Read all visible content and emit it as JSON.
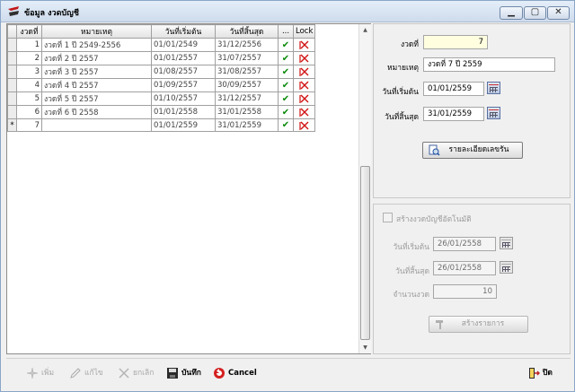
{
  "window": {
    "title": "ข้อมูล งวดบัญชี",
    "controls": {
      "minimize": "▁",
      "maximize": "▢",
      "close": "✕"
    }
  },
  "grid": {
    "columns": [
      "งวดที่",
      "หมายเหตุ",
      "วันที่เริ่มต้น",
      "วันที่สิ้นสุด",
      "...",
      "Lock"
    ],
    "rows": [
      {
        "period": "1",
        "note": "งวดที่ 1 ปี 2549-2556",
        "start": "01/01/2549",
        "end": "31/12/2556"
      },
      {
        "period": "2",
        "note": "งวดที่ 2 ปี 2557",
        "start": "01/01/2557",
        "end": "31/07/2557"
      },
      {
        "period": "3",
        "note": "งวดที่ 3 ปี 2557",
        "start": "01/08/2557",
        "end": "31/08/2557"
      },
      {
        "period": "4",
        "note": "งวดที่ 4 ปี 2557",
        "start": "01/09/2557",
        "end": "30/09/2557"
      },
      {
        "period": "5",
        "note": "งวดที่ 5 ปี 2557",
        "start": "01/10/2557",
        "end": "31/12/2557"
      },
      {
        "period": "6",
        "note": "งวดที่ 6 ปี 2558",
        "start": "01/01/2558",
        "end": "31/01/2558"
      },
      {
        "period": "7",
        "note": "",
        "start": "01/01/2559",
        "end": "31/01/2559"
      }
    ],
    "new_row_marker": "*",
    "check_glyph": "✔"
  },
  "detail": {
    "period_label": "งวดที่",
    "period_value": "7",
    "note_label": "หมายเหตุ",
    "note_value": "งวดที่ 7 ปี 2559",
    "start_label": "วันที่เริ่มต้น",
    "start_value": "01/01/2559",
    "end_label": "วันที่สิ้นสุด",
    "end_value": "31/01/2559",
    "details_button": "รายละเอียดเลขรัน"
  },
  "auto": {
    "checkbox_label": "สร้างงวดบัญชีอัตโนมัติ",
    "start_label": "วันที่เริ่มต้น",
    "start_value": "26/01/2558",
    "end_label": "วันที่สิ้นสุด",
    "end_value": "26/01/2558",
    "count_label": "จำนวนงวด",
    "count_value": "10",
    "create_button": "สร้างรายการ"
  },
  "toolbar": {
    "add": "เพิ่ม",
    "edit": "แก้ไข",
    "cancel_th": "ยกเลิก",
    "save": "บันทึก",
    "cancel": "Cancel",
    "close": "ปิด"
  },
  "colors": {
    "check": "#0a8a0a",
    "lock": "#d01010",
    "highlight_input": "#ffffe0"
  }
}
